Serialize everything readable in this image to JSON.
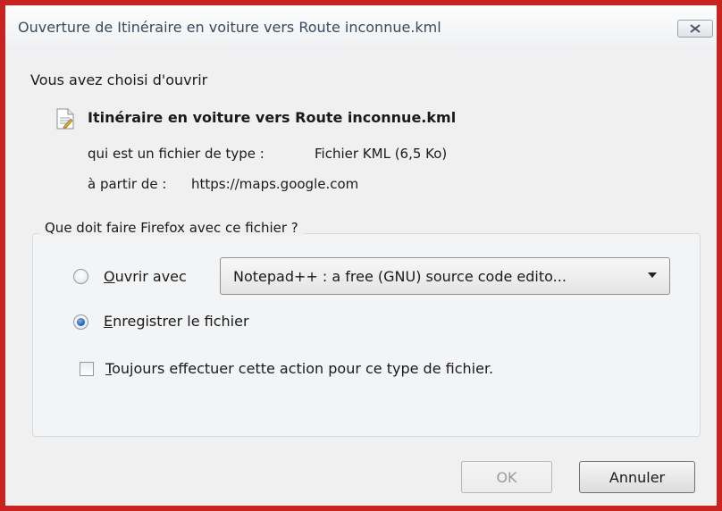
{
  "window": {
    "title": "Ouverture de Itinéraire en voiture vers Route inconnue.kml",
    "close_icon": "close-x-icon"
  },
  "dialog": {
    "heading": "Vous avez choisi d'ouvrir",
    "file_icon": "document-icon",
    "filename": "Itinéraire en voiture vers Route inconnue.kml",
    "type_label": "qui est un fichier de type :",
    "type_value": "Fichier KML (6,5 Ko)",
    "source_label": "à partir de :",
    "source_value": "https://maps.google.com"
  },
  "action_group": {
    "legend": "Que doit faire Firefox avec ce fichier ?",
    "open_with": {
      "accel": "O",
      "rest": "uvrir avec",
      "selected": false
    },
    "open_with_app": "Notepad++ : a free (GNU) source code edito...",
    "save": {
      "accel": "E",
      "rest": "nregistrer le fichier",
      "selected": true
    },
    "always": {
      "accel": "T",
      "rest": "oujours effectuer cette action pour ce type de fichier.",
      "checked": false
    }
  },
  "buttons": {
    "ok": "OK",
    "ok_enabled": false,
    "cancel": "Annuler"
  },
  "colors": {
    "outer_border": "#c8241f",
    "dialog_bg": "#f0f0f0",
    "title_text": "#3a4a5c"
  }
}
